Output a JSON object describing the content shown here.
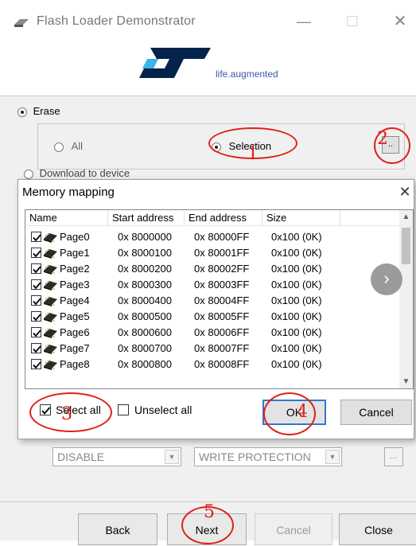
{
  "window": {
    "title": "Flash Loader Demonstrator",
    "icon": "app-icon",
    "minimize_glyph": "—",
    "maximize_glyph": "☐",
    "close_glyph": "✕"
  },
  "branding": {
    "logo": "st-logo",
    "tagline": "life.augmented"
  },
  "operations": {
    "erase_label": "Erase",
    "erase_all_label": "All",
    "erase_selection_label": "Selection",
    "browse_label": "..",
    "download_label": "Download to device"
  },
  "protection": {
    "dropdown1_value": "DISABLE",
    "dropdown2_value": "WRITE PROTECTION",
    "dots_label": "..."
  },
  "navigation": {
    "back": "Back",
    "next": "Next",
    "cancel": "Cancel",
    "close": "Close"
  },
  "memory_dialog": {
    "title": "Memory mapping",
    "close_glyph": "✕",
    "columns": [
      "Name",
      "Start address",
      "End address",
      "Size"
    ],
    "rows": [
      {
        "name": "Page0",
        "start": "0x 8000000",
        "end": "0x 80000FF",
        "size": "0x100 (0K)",
        "checked": true
      },
      {
        "name": "Page1",
        "start": "0x 8000100",
        "end": "0x 80001FF",
        "size": "0x100 (0K)",
        "checked": true
      },
      {
        "name": "Page2",
        "start": "0x 8000200",
        "end": "0x 80002FF",
        "size": "0x100 (0K)",
        "checked": true
      },
      {
        "name": "Page3",
        "start": "0x 8000300",
        "end": "0x 80003FF",
        "size": "0x100 (0K)",
        "checked": true
      },
      {
        "name": "Page4",
        "start": "0x 8000400",
        "end": "0x 80004FF",
        "size": "0x100 (0K)",
        "checked": true
      },
      {
        "name": "Page5",
        "start": "0x 8000500",
        "end": "0x 80005FF",
        "size": "0x100 (0K)",
        "checked": true
      },
      {
        "name": "Page6",
        "start": "0x 8000600",
        "end": "0x 80006FF",
        "size": "0x100 (0K)",
        "checked": true
      },
      {
        "name": "Page7",
        "start": "0x 8000700",
        "end": "0x 80007FF",
        "size": "0x100 (0K)",
        "checked": true
      },
      {
        "name": "Page8",
        "start": "0x 8000800",
        "end": "0x 80008FF",
        "size": "0x100 (0K)",
        "checked": true
      }
    ],
    "select_all_label": "Select all",
    "select_all_checked": true,
    "unselect_all_label": "Unselect all",
    "unselect_all_checked": false,
    "ok_label": "OK",
    "cancel_label": "Cancel"
  },
  "annotations": {
    "marks": [
      "1",
      "2",
      "3",
      "4",
      "5"
    ],
    "color": "#e0201a"
  },
  "colors": {
    "st_blue": "#03234b",
    "st_accent": "#3cb4e6",
    "focus_border": "#3377cc"
  }
}
